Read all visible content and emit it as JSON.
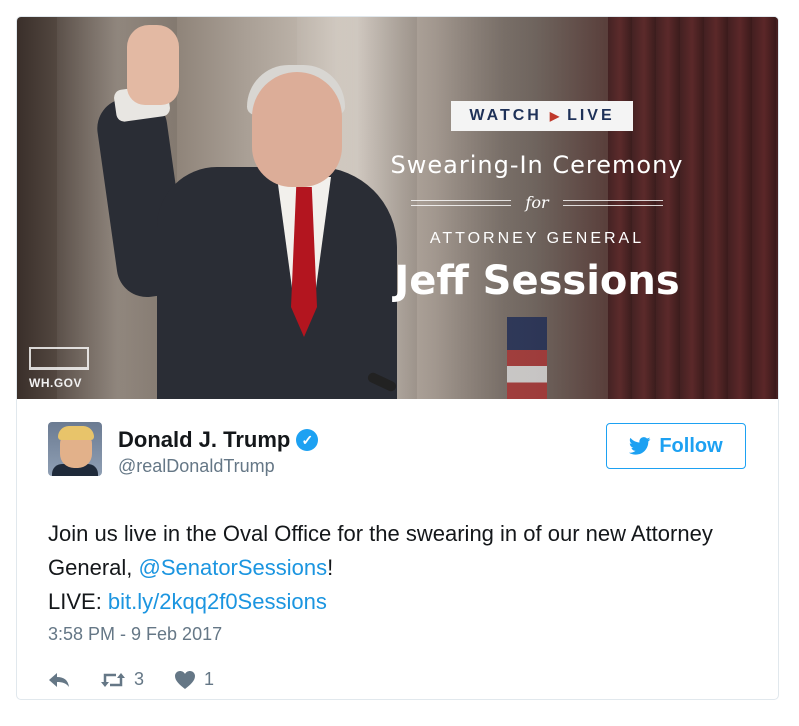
{
  "media": {
    "badge_left": "WATCH",
    "badge_right": "LIVE",
    "ceremony": "Swearing-In Ceremony",
    "for": "for",
    "subtitle": "ATTORNEY GENERAL",
    "name": "Jeff Sessions",
    "logo_text": "WH.GOV"
  },
  "user": {
    "display_name": "Donald J. Trump",
    "handle": "@realDonaldTrump",
    "verified": true
  },
  "follow_label": "Follow",
  "tweet": {
    "text_part1": "Join us live in the Oval Office for the swearing in of our new Attorney General, ",
    "mention": "@SenatorSessions",
    "text_part2": "!",
    "live_label": "LIVE: ",
    "link": "bit.ly/2kqq2f0Sessions",
    "timestamp": "3:58 PM - 9 Feb 2017"
  },
  "actions": {
    "retweets": "3",
    "likes": "1"
  },
  "colors": {
    "accent": "#1da1f2",
    "link": "#1b95e0",
    "muted": "#657786",
    "badge_text": "#1e3158"
  },
  "icons": [
    "reply-icon",
    "retweet-icon",
    "heart-icon",
    "twitter-bird-icon",
    "verified-badge-icon"
  ]
}
